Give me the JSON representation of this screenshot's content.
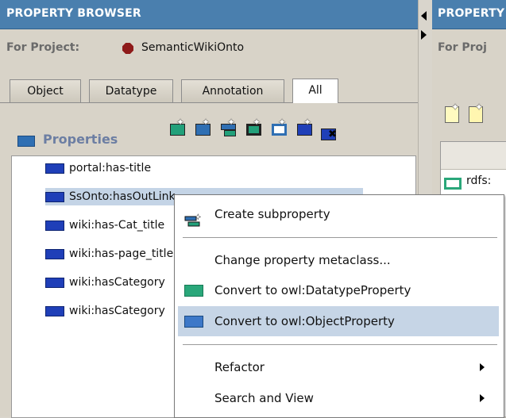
{
  "left_panel": {
    "title": "PROPERTY BROWSER",
    "project_label": "For Project:",
    "project_name": "SemanticWikiOnto",
    "tabs": [
      {
        "label": "Object"
      },
      {
        "label": "Datatype"
      },
      {
        "label": "Annotation"
      },
      {
        "label": "All",
        "active": true
      }
    ],
    "properties_label": "Properties",
    "toolbar_icons": [
      "create-property-icon",
      "create-object-property-icon",
      "create-subproperty-icon",
      "create-datatype-property-icon",
      "create-annotation-property-icon",
      "create-object-property-alt-icon",
      "delete-property-icon"
    ],
    "tree_items": [
      {
        "label": "portal:has-title"
      },
      {
        "label": "SsOnto:hasOutLink",
        "selected": true
      },
      {
        "label": "wiki:has-Cat_title"
      },
      {
        "label": "wiki:has-page_title"
      },
      {
        "label": "wiki:hasCategory"
      },
      {
        "label": "wiki:hasCategory"
      }
    ]
  },
  "right_panel": {
    "title": "PROPERTY",
    "project_label": "For Proj",
    "row_label": "rdfs:"
  },
  "context_menu": {
    "items": [
      {
        "label": "Create subproperty"
      },
      {
        "label": "Change property metaclass..."
      },
      {
        "label": "Convert to owl:DatatypeProperty"
      },
      {
        "label": "Convert to owl:ObjectProperty",
        "highlighted": true
      },
      {
        "label": "Refactor"
      },
      {
        "label": "Search and View"
      }
    ]
  },
  "colors": {
    "title_bar": "#4a7fae",
    "object_property": "#1f3fb8",
    "datatype_property": "#2aa77a",
    "highlight": "#c6d5e6"
  }
}
